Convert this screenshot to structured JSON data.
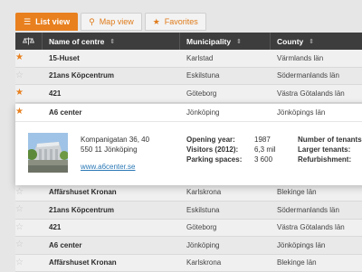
{
  "tabs": [
    {
      "label": "List view",
      "icon": "list-icon",
      "active": true
    },
    {
      "label": "Map view",
      "icon": "map-pin-icon",
      "active": false
    },
    {
      "label": "Favorites",
      "icon": "star-icon",
      "active": false
    }
  ],
  "table": {
    "headers": {
      "name": "Name of centre",
      "municipality": "Municipality",
      "county": "County"
    },
    "rows_top": [
      {
        "name": "15-Huset",
        "municipality": "Karlstad",
        "county": "Värmlands län",
        "favorite": true
      },
      {
        "name": "21ans Köpcentrum",
        "municipality": "Eskilstuna",
        "county": "Södermanlands län",
        "favorite": false
      },
      {
        "name": "421",
        "municipality": "Göteborg",
        "county": "Västra Götalands län",
        "favorite": true
      }
    ],
    "expanded": {
      "name": "A6 center",
      "municipality": "Jönköping",
      "county": "Jönköpings län",
      "favorite": true,
      "address_line1": "Kompanigatan 36, 40",
      "address_line2": "550 11 Jönköping",
      "website": "www.a6center.se",
      "facts": [
        {
          "label": "Opening year:",
          "value": "1987"
        },
        {
          "label": "Visitors (2012):",
          "value": "6,3 mil"
        },
        {
          "label": "Parking spaces:",
          "value": "3 600"
        }
      ],
      "facts2": [
        "Number of tenants:",
        "Larger tenants:",
        "Refurbishment:"
      ]
    },
    "rows_bottom": [
      {
        "name": "Affärshuset Kronan",
        "municipality": "Karlskrona",
        "county": "Blekinge län",
        "favorite": false
      },
      {
        "name": "21ans Köpcentrum",
        "municipality": "Eskilstuna",
        "county": "Södermanlands län",
        "favorite": false
      },
      {
        "name": "421",
        "municipality": "Göteborg",
        "county": "Västra Götalands län",
        "favorite": false
      },
      {
        "name": "A6 center",
        "municipality": "Jönköping",
        "county": "Jönköpings län",
        "favorite": false
      },
      {
        "name": "Affärshuset Kronan",
        "municipality": "Karlskrona",
        "county": "Blekinge län",
        "favorite": false
      }
    ]
  },
  "colors": {
    "accent": "#e8801f",
    "header_bg": "#3d3d3d",
    "link": "#2a78b5"
  }
}
